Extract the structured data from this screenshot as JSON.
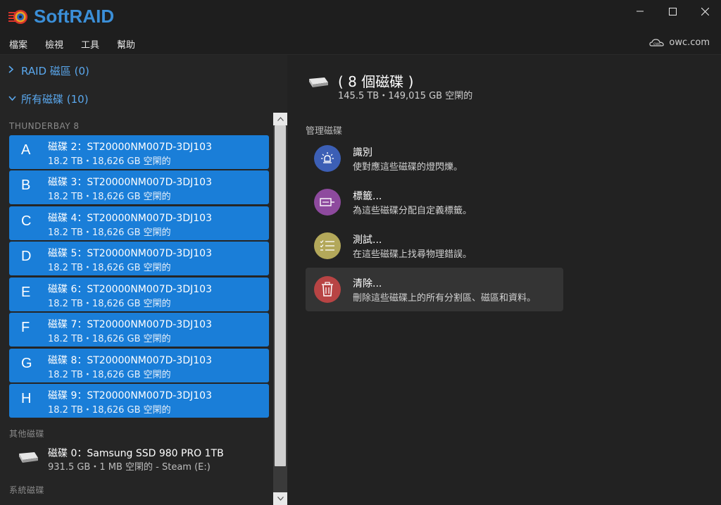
{
  "app": {
    "title": "SoftRAID",
    "brand_color": "#3b8fd8",
    "window_controls": [
      "minimize-icon",
      "maximize-icon",
      "close-icon"
    ]
  },
  "menu": {
    "items": [
      {
        "label": "檔案"
      },
      {
        "label": "檢視"
      },
      {
        "label": "工具"
      },
      {
        "label": "幫助"
      }
    ],
    "owc_label": "owc.com"
  },
  "sidebar": {
    "raid_header": "RAID 磁區 (0)",
    "all_disks_header": "所有磁碟 (10)",
    "enclosure_label": "THUNDERBAY 8",
    "selected_color": "#1a7ed8",
    "disks": [
      {
        "letter": "A",
        "name": "磁碟 2：ST20000NM007D-3DJ103",
        "detail": "18.2 TB・18,626 GB 空閑的"
      },
      {
        "letter": "B",
        "name": "磁碟 3：ST20000NM007D-3DJ103",
        "detail": "18.2 TB・18,626 GB 空閑的"
      },
      {
        "letter": "C",
        "name": "磁碟 4：ST20000NM007D-3DJ103",
        "detail": "18.2 TB・18,626 GB 空閑的"
      },
      {
        "letter": "D",
        "name": "磁碟 5：ST20000NM007D-3DJ103",
        "detail": "18.2 TB・18,626 GB 空閑的"
      },
      {
        "letter": "E",
        "name": "磁碟 6：ST20000NM007D-3DJ103",
        "detail": "18.2 TB・18,626 GB 空閑的"
      },
      {
        "letter": "F",
        "name": "磁碟 7：ST20000NM007D-3DJ103",
        "detail": "18.2 TB・18,626 GB 空閑的"
      },
      {
        "letter": "G",
        "name": "磁碟 8：ST20000NM007D-3DJ103",
        "detail": "18.2 TB・18,626 GB 空閑的"
      },
      {
        "letter": "H",
        "name": "磁碟 9：ST20000NM007D-3DJ103",
        "detail": "18.2 TB・18,626 GB 空閑的"
      }
    ],
    "other_label": "其他磁碟",
    "other_disk": {
      "name": "磁碟 0：Samsung SSD 980 PRO 1TB",
      "detail": "931.5 GB・1 MB 空閑的 - Steam (E:)"
    },
    "system_label": "系統磁碟"
  },
  "main": {
    "title": "( 8 個磁碟 )",
    "subtitle": "145.5 TB・149,015 GB 空閑的",
    "section_label": "管理磁碟",
    "actions": [
      {
        "title": "識別",
        "desc": "使對應這些磁碟的燈閃爍。",
        "icon": "lightbulb-icon",
        "color": "#3c5fb5"
      },
      {
        "title": "標籤...",
        "desc": "為這些磁碟分配自定義標籤。",
        "icon": "tag-icon",
        "color": "#8e4a9e"
      },
      {
        "title": "測試...",
        "desc": "在這些磁碟上找尋物理錯誤。",
        "icon": "checklist-icon",
        "color": "#b3a85a"
      },
      {
        "title": "清除...",
        "desc": "刪除這些磁碟上的所有分割區、磁區和資料。",
        "icon": "trash-icon",
        "color": "#b84444"
      }
    ]
  }
}
